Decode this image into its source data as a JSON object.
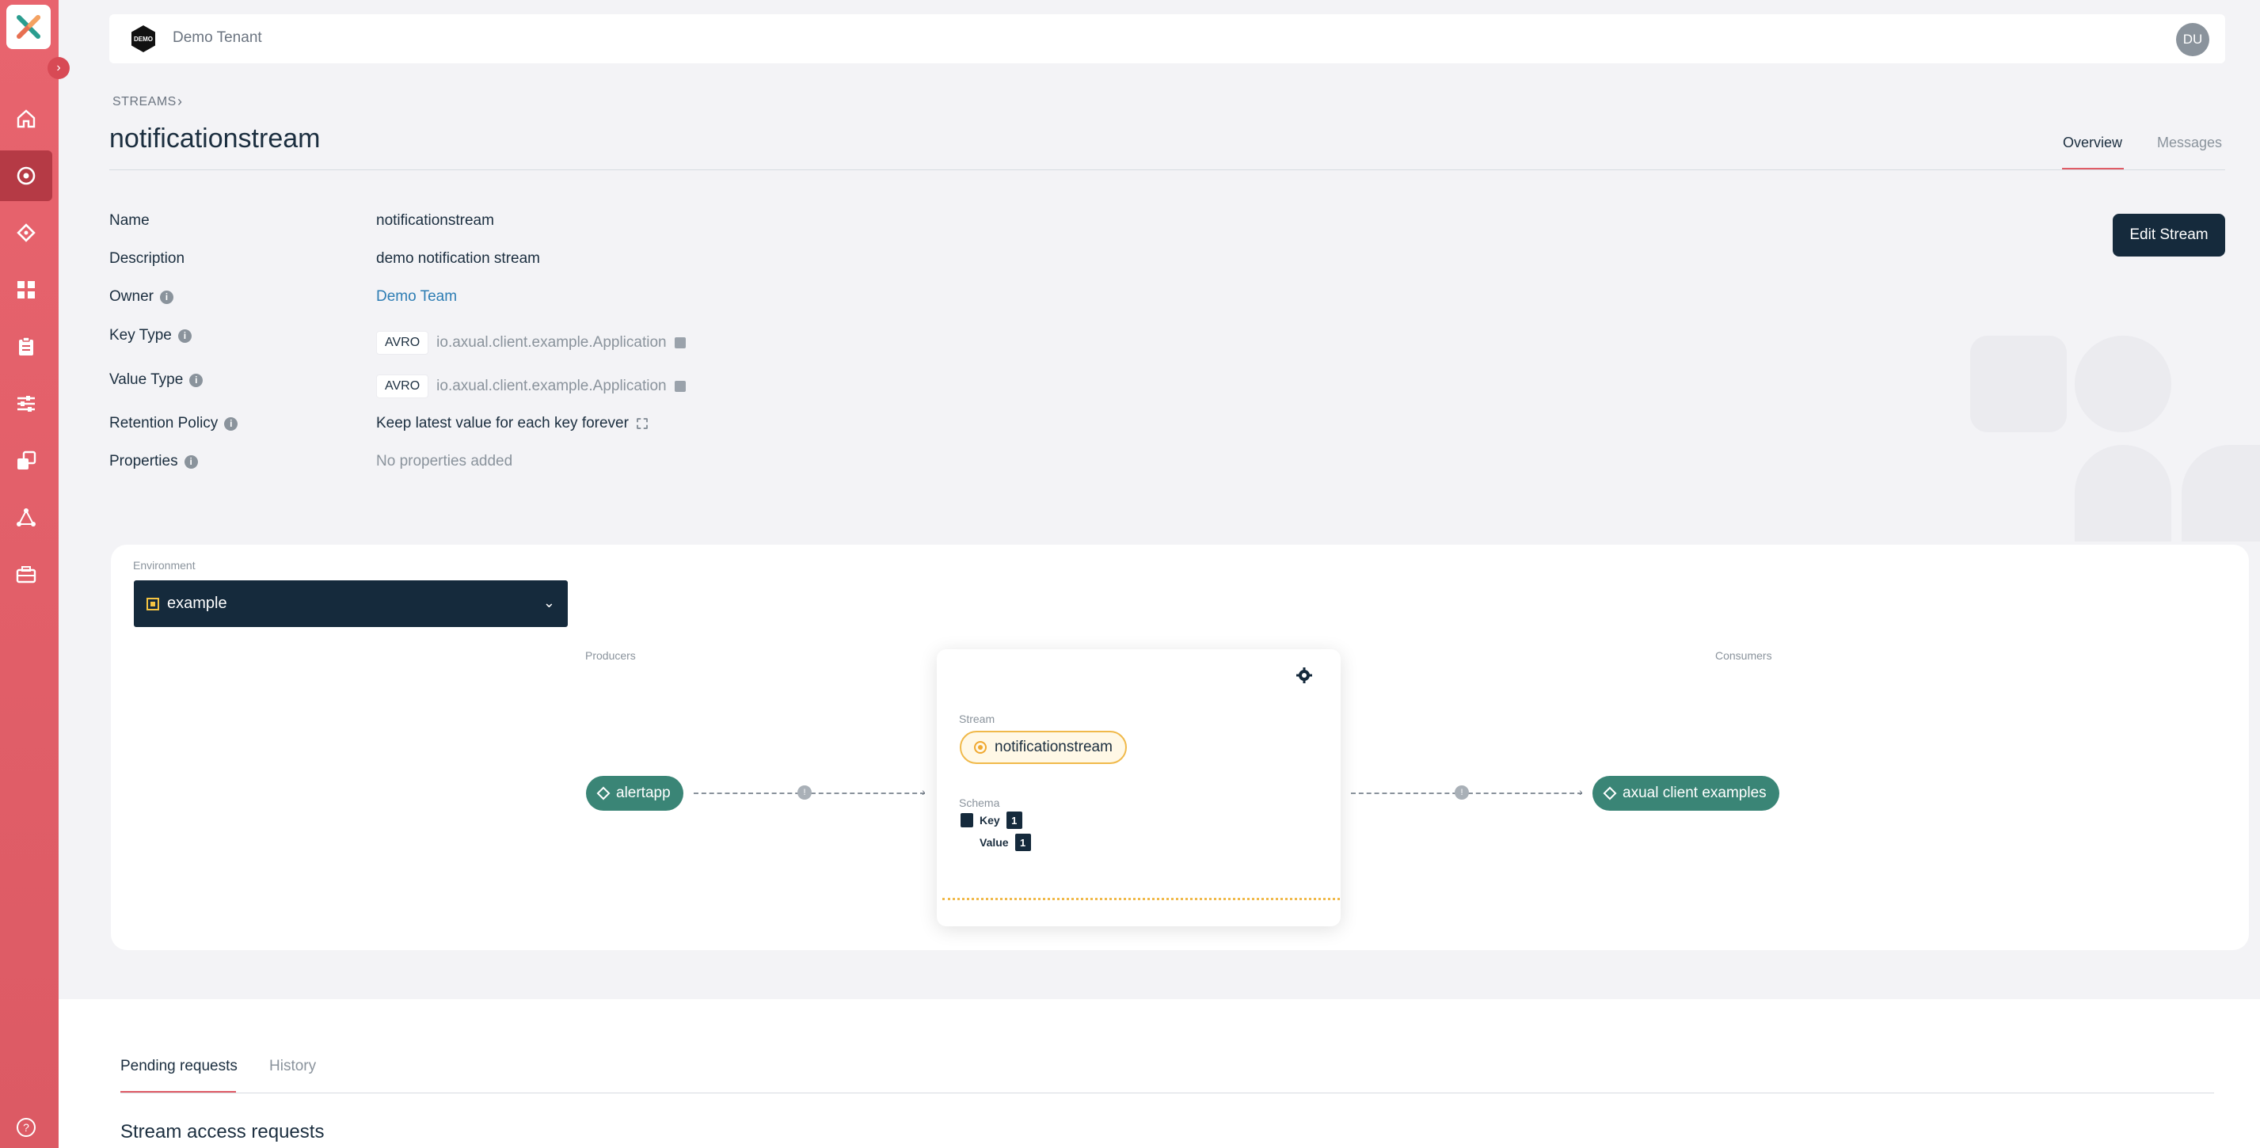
{
  "tenant": {
    "logo_text": "DEMO",
    "name": "Demo Tenant",
    "user_initials": "DU"
  },
  "breadcrumb": {
    "root": "STREAMS",
    "separator": "›"
  },
  "page": {
    "title": "notificationstream",
    "tabs": [
      "Overview",
      "Messages"
    ],
    "active_tab": "Overview"
  },
  "properties": {
    "name": {
      "label": "Name",
      "value": "notificationstream"
    },
    "description": {
      "label": "Description",
      "value": "demo notification stream"
    },
    "owner": {
      "label": "Owner",
      "value": "Demo Team"
    },
    "key_type": {
      "label": "Key Type",
      "format": "AVRO",
      "value": "io.axual.client.example.Application"
    },
    "value_type": {
      "label": "Value Type",
      "format": "AVRO",
      "value": "io.axual.client.example.Application"
    },
    "retention": {
      "label": "Retention Policy",
      "value": "Keep latest value for each key forever"
    },
    "properties": {
      "label": "Properties",
      "value": "No properties added"
    }
  },
  "actions": {
    "edit_stream": "Edit Stream"
  },
  "environment": {
    "label": "Environment",
    "selected": "example"
  },
  "topology": {
    "producers_label": "Producers",
    "consumers_label": "Consumers",
    "producer": "alertapp",
    "consumer": "axual client examples",
    "stream_label": "Stream",
    "stream_name": "notificationstream",
    "schema_label": "Schema",
    "schema_key_label": "Key",
    "schema_key_version": "1",
    "schema_value_label": "Value",
    "schema_value_version": "1",
    "connector_info": "!"
  },
  "requests": {
    "tabs": [
      "Pending requests",
      "History"
    ],
    "active_tab": "Pending requests",
    "section_title": "Stream access requests"
  },
  "colors": {
    "sidebar": "#e05c66",
    "primary_dark": "#152a3c",
    "app_green": "#3a8576",
    "stream_orange": "#f0b94a",
    "link": "#2d7db4"
  },
  "sidebar_icons": [
    "home-icon",
    "streams-icon",
    "applications-icon",
    "dashboard-icon",
    "schemas-icon",
    "settings-sliders-icon",
    "environments-icon",
    "connectors-icon",
    "instances-icon"
  ],
  "help_icon": "question-icon"
}
